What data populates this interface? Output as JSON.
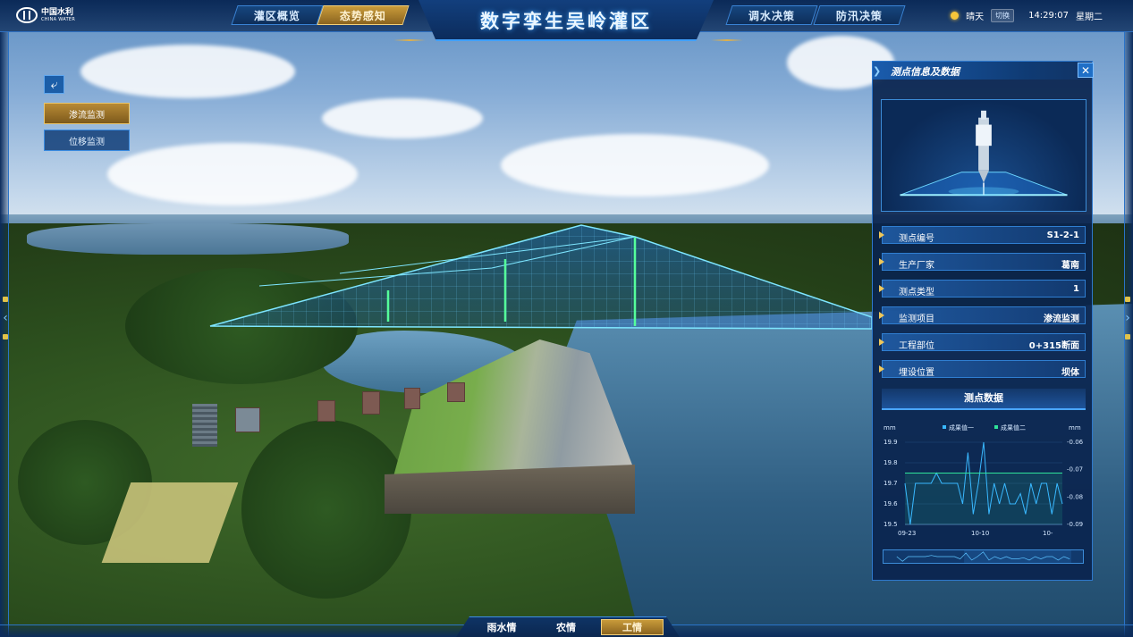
{
  "header": {
    "logo_cn": "中国水利",
    "logo_en": "CHINA WATER",
    "title": "数字孪生吴岭灌区",
    "tabs": [
      "灌区概览",
      "态势感知",
      "调水决策",
      "防汛决策"
    ],
    "active_tab": "态势感知",
    "weather": "晴天",
    "switch_label": "切换",
    "time": "14:29:07",
    "weekday": "星期二"
  },
  "side": {
    "buttons": [
      "渗流监测",
      "位移监测"
    ],
    "active": "渗流监测"
  },
  "panel": {
    "title": "测点信息及数据",
    "rows": [
      {
        "label": "测点编号",
        "value": "S1-2-1"
      },
      {
        "label": "生产厂家",
        "value": "葛南"
      },
      {
        "label": "测点类型",
        "value": "1"
      },
      {
        "label": "监测项目",
        "value": "渗流监测"
      },
      {
        "label": "工程部位",
        "value": "0+315断面"
      },
      {
        "label": "埋设位置",
        "value": "坝体"
      }
    ],
    "data_title": "测点数据"
  },
  "chart_data": {
    "type": "line",
    "y_unit_left": "mm",
    "y_unit_right": "mm",
    "ylim_left": [
      19.5,
      19.9
    ],
    "yticks_left": [
      "19.9",
      "19.8",
      "19.7",
      "19.6",
      "19.5"
    ],
    "ylim_right": [
      -0.09,
      -0.06
    ],
    "yticks_right": [
      "-0.06",
      "-0.07",
      "-0.08",
      "-0.09"
    ],
    "xticks": [
      "09-23",
      "10-10",
      "10-"
    ],
    "series": [
      {
        "name": "成果值一",
        "color": "#39b8ff",
        "values": [
          19.7,
          19.5,
          19.7,
          19.7,
          19.7,
          19.7,
          19.75,
          19.7,
          19.7,
          19.7,
          19.7,
          19.6,
          19.85,
          19.55,
          19.7,
          19.9,
          19.55,
          19.7,
          19.6,
          19.7,
          19.6,
          19.6,
          19.65,
          19.55,
          19.7,
          19.6,
          19.7,
          19.7,
          19.55,
          19.7,
          19.6
        ]
      },
      {
        "name": "成果值二",
        "color": "#2fe39a",
        "values": [
          19.75,
          19.75,
          19.75,
          19.75,
          19.75,
          19.75,
          19.75,
          19.75,
          19.75,
          19.75,
          19.75,
          19.75,
          19.75,
          19.75,
          19.75,
          19.75,
          19.75,
          19.75,
          19.75,
          19.75,
          19.75,
          19.75,
          19.75,
          19.75,
          19.75,
          19.75,
          19.75,
          19.75,
          19.75,
          19.75,
          19.75
        ]
      }
    ],
    "grid": true,
    "legend": "top-center"
  },
  "bottom": {
    "tabs": [
      "雨水情",
      "农情",
      "工情"
    ],
    "active": "工情"
  },
  "colors": {
    "accent": "#3da3ff",
    "gold": "#c99b3a",
    "panel_bg": "#0a244e"
  }
}
